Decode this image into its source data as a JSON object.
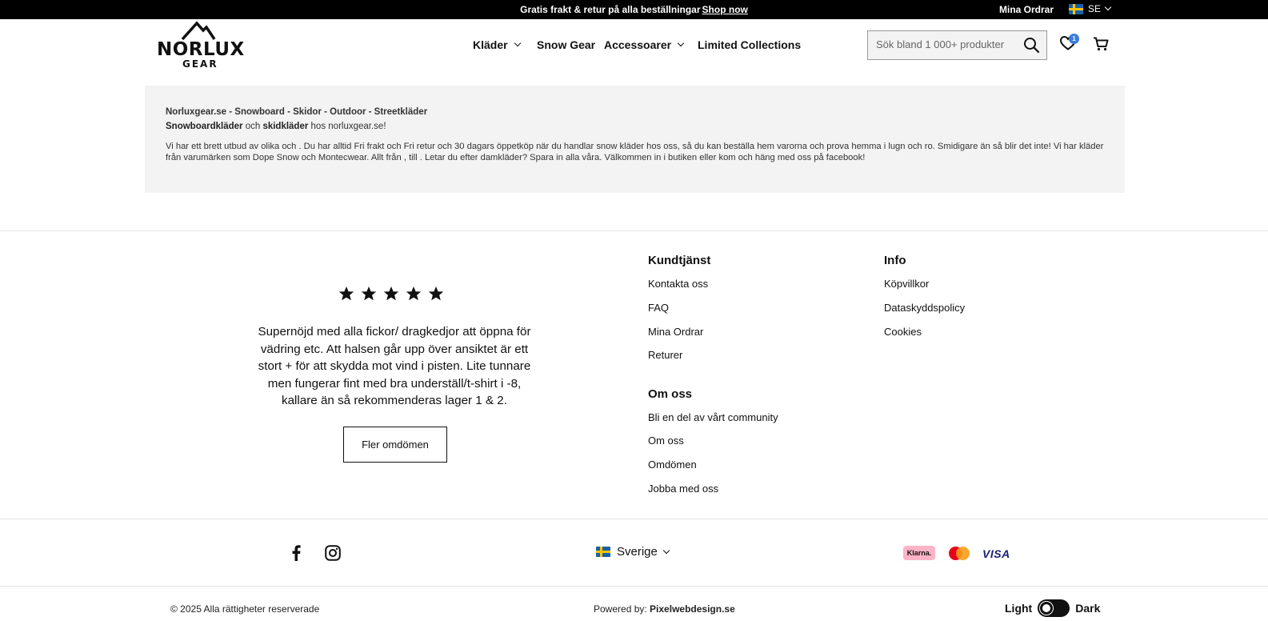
{
  "topbar": {
    "promo_text": "Gratis frakt & retur på alla beställningar",
    "promo_link": "Shop now",
    "orders_link": "Mina Ordrar",
    "language": "SE"
  },
  "header": {
    "logo_top": "NORLUX",
    "logo_bottom": "GEAR",
    "nav": [
      {
        "label": "Kläder",
        "dropdown": true
      },
      {
        "label": "Snow Gear",
        "dropdown": false
      },
      {
        "label": "Accessoarer",
        "dropdown": true
      },
      {
        "label": "Limited Collections",
        "dropdown": false
      }
    ],
    "search_placeholder": "Sök bland 1 000+ produkter",
    "wishlist_count": "1"
  },
  "seo": {
    "line1": "Norluxgear.se - Snowboard - Skidor - Outdoor - Streetkläder",
    "line2_a": "Snowboardkläder",
    "line2_b": " och ",
    "line2_c": "skidkläder",
    "line2_d": " hos norluxgear.se!",
    "body": "Vi har ett brett utbud av olika och . Du har alltid Fri frakt och Fri retur och 30 dagars öppetköp när du handlar snow kläder hos oss, så du kan beställa hem varorna och prova hemma i lugn och ro. Smidigare än så blir det inte! Vi har kläder från varumärken som Dope Snow och Montecwear. Allt från , till . Letar du efter damkläder? Spara in alla våra. Välkommen in i butiken eller kom och häng med oss på facebook!"
  },
  "review": {
    "rating": 5,
    "text": "Supernöjd med alla fickor/ dragkedjor att öppna för vädring etc. Att halsen går upp över ansiktet är ett stort + för att skydda mot vind i pisten. Lite tunnare men fungerar fint med bra underställ/t-shirt i -8, kallare än så rekommenderas lager 1 & 2.",
    "more_button": "Fler omdömen"
  },
  "footer": {
    "kundtjanst": {
      "title": "Kundtjänst",
      "links": [
        "Kontakta oss",
        "FAQ",
        "Mina Ordrar",
        "Returer"
      ]
    },
    "info": {
      "title": "Info",
      "links": [
        "Köpvillkor",
        "Dataskyddspolicy",
        "Cookies"
      ]
    },
    "om_oss": {
      "title": "Om oss",
      "links": [
        "Bli en del av vårt community",
        "Om oss",
        "Omdömen",
        "Jobba med oss"
      ]
    },
    "country": "Sverige",
    "payment": {
      "klarna": "Klarna.",
      "visa": "VISA"
    },
    "copyright": "© 2025 Alla rättigheter reserverade",
    "powered_label": "Powered by: ",
    "powered_by": "Pixelwebdesign.se",
    "theme_light": "Light",
    "theme_dark": "Dark"
  }
}
